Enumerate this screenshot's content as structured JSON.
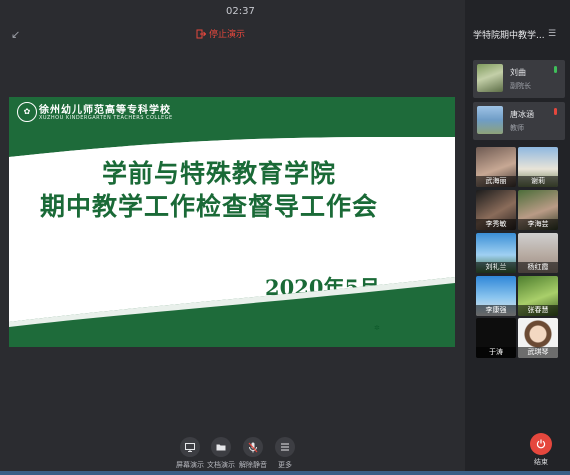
{
  "timer": "02:37",
  "stop_label": "停止演示",
  "sidebar_title": "学特院期中教学...",
  "slide": {
    "college_cn": "徐州幼儿师范高等专科学校",
    "college_en": "XUZHOU KINDERGARTEN TEACHERS COLLEGE",
    "title_line1": "学前与特殊教育学院",
    "title_line2": "期中教学工作检查督导工作会",
    "date": "2020年5月"
  },
  "speakers": [
    {
      "name": "刘曲",
      "role": "副院长",
      "mic_color": "#3fbf5a"
    },
    {
      "name": "唐冰涵",
      "role": "教师",
      "mic_color": "#e5473d"
    }
  ],
  "participants": [
    {
      "name": "武海丽"
    },
    {
      "name": "谢莉"
    },
    {
      "name": "李秀敏"
    },
    {
      "name": "李海芸"
    },
    {
      "name": "刘礼兰"
    },
    {
      "name": "杨红霞"
    },
    {
      "name": "李康强"
    },
    {
      "name": "张春慧"
    },
    {
      "name": "于涛"
    },
    {
      "name": "武琪琴"
    }
  ],
  "toolbar": {
    "screen_share": "屏幕演示",
    "doc_share": "文档演示",
    "unmute": "解除静音",
    "more": "更多",
    "end": "结束"
  },
  "colors": {
    "accent_green": "#1e6b3a",
    "danger": "#e5473d"
  }
}
